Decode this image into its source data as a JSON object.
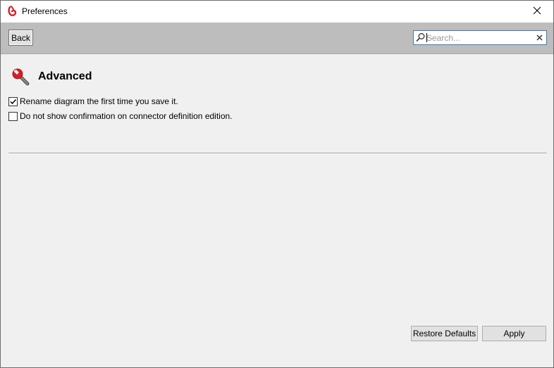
{
  "window": {
    "title": "Preferences",
    "app_icon": "bonita-logo-icon",
    "close_icon": "close-icon"
  },
  "toolbar": {
    "back_label": "Back",
    "search": {
      "placeholder": "Search...",
      "value": "",
      "search_icon": "search-icon",
      "clear_icon": "clear-icon"
    }
  },
  "page": {
    "title": "Advanced",
    "icon": "wrench-icon",
    "options": [
      {
        "label": "Rename diagram the first time you save it.",
        "checked": true
      },
      {
        "label": "Do not show confirmation on connector definition edition.",
        "checked": false
      }
    ]
  },
  "footer": {
    "restore_defaults_label": "Restore Defaults",
    "apply_label": "Apply"
  },
  "colors": {
    "toolbar_bg": "#bdbdbd",
    "window_bg": "#f0f0f0",
    "accent_red": "#d32027",
    "search_border": "#3c7fb1"
  }
}
